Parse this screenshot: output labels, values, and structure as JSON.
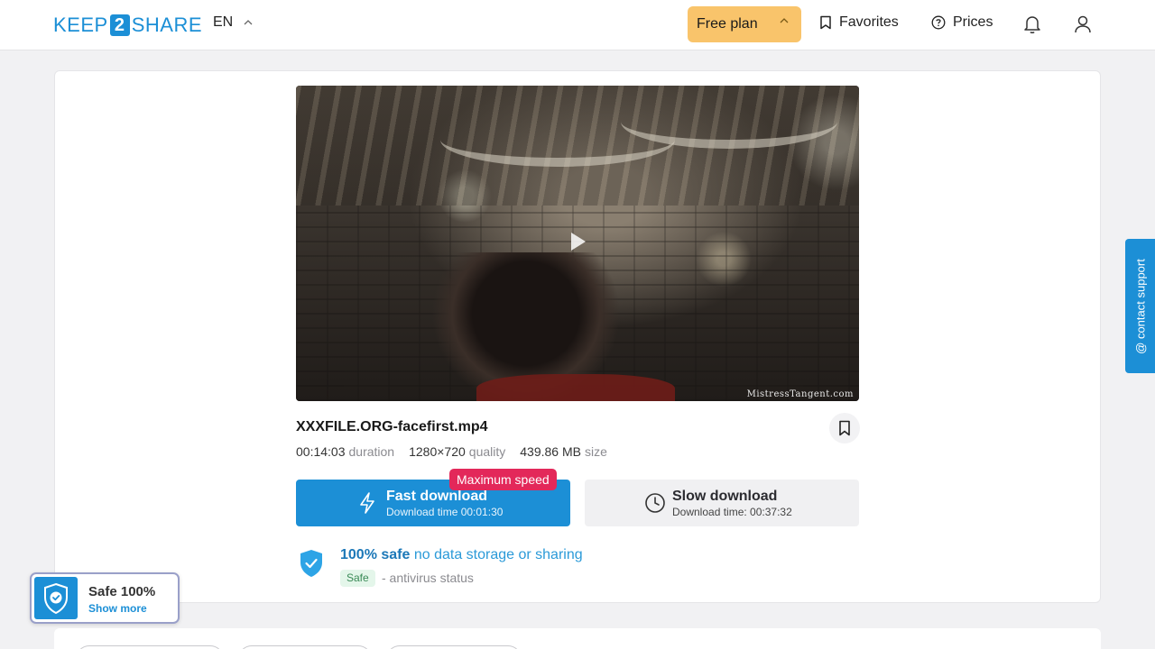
{
  "header": {
    "logo": {
      "left": "KEEP",
      "middle": "2",
      "right": "SHARE"
    },
    "language": "EN",
    "free_plan_label": "Free plan",
    "favorites_label": "Favorites",
    "prices_label": "Prices"
  },
  "file": {
    "name": "XXXFILE.ORG-facefirst.mp4",
    "duration_value": "00:14:03",
    "duration_label": "duration",
    "quality_value": "1280×720",
    "quality_label": "quality",
    "size_value": "439.86 MB",
    "size_label": "size",
    "watermark": "MistressTangent.com"
  },
  "download": {
    "max_speed_badge": "Maximum speed",
    "fast_title": "Fast download",
    "fast_subtitle": "Download time 00:01:30",
    "slow_title": "Slow download",
    "slow_subtitle": "Download time: 00:37:32"
  },
  "safety": {
    "strong": "100% safe",
    "rest": "no data storage or sharing",
    "badge": "Safe",
    "status": "- antivirus status"
  },
  "support_label": "@ contact support",
  "safe_widget": {
    "title": "Safe 100%",
    "link": "Show more"
  },
  "colors": {
    "accent": "#1c8fd6",
    "plan": "#f9c46b",
    "badge": "#e3285a"
  }
}
